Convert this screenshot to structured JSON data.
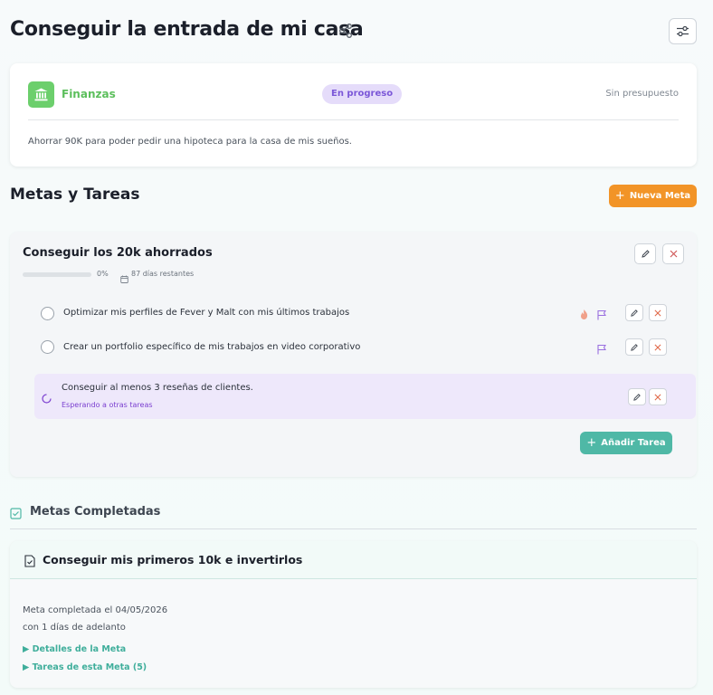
{
  "header": {
    "title": "Conseguir la entrada de mi casa"
  },
  "info": {
    "category": "Finanzas",
    "status": "En progreso",
    "budget": "Sin presupuesto",
    "description": "Ahorrar 90K para poder pedir una hipoteca para la casa de mis sueños."
  },
  "goals_section": {
    "title": "Metas y Tareas",
    "new_goal_label": "Nueva Meta"
  },
  "goal": {
    "title": "Conseguir los 20k ahorrados",
    "progress": 0,
    "progress_label": "0%",
    "days_left": "87 días restantes",
    "tasks": [
      {
        "text": "Optimizar mis perfiles de Fever y Malt con mis últimos trabajos",
        "flags": [
          "fire-icon",
          "flag-icon"
        ]
      },
      {
        "text": "Crear un portfolio específico de mis trabajos en video corporativo",
        "flags": [
          "flag-icon"
        ]
      },
      {
        "text": "Conseguir al menos 3 reseñas de clientes.",
        "waiting": "Esperando a otras tareas"
      }
    ],
    "add_task_label": "Añadir Tarea"
  },
  "completed": {
    "title": "Metas Completadas",
    "item": {
      "title": "Conseguir mis primeros 10k e invertirlos",
      "completed_on": "Meta completada el 04/05/2026",
      "ahead": "con 1 días de adelanto",
      "details_link": "Detalles de la Meta",
      "tasks_link": "Tareas de esta Meta (5)"
    }
  },
  "colors": {
    "accent_orange": "#f29427",
    "accent_teal": "#4fb8a6",
    "status_purple": "#7b57d8",
    "category_green": "#6ccf6c"
  }
}
